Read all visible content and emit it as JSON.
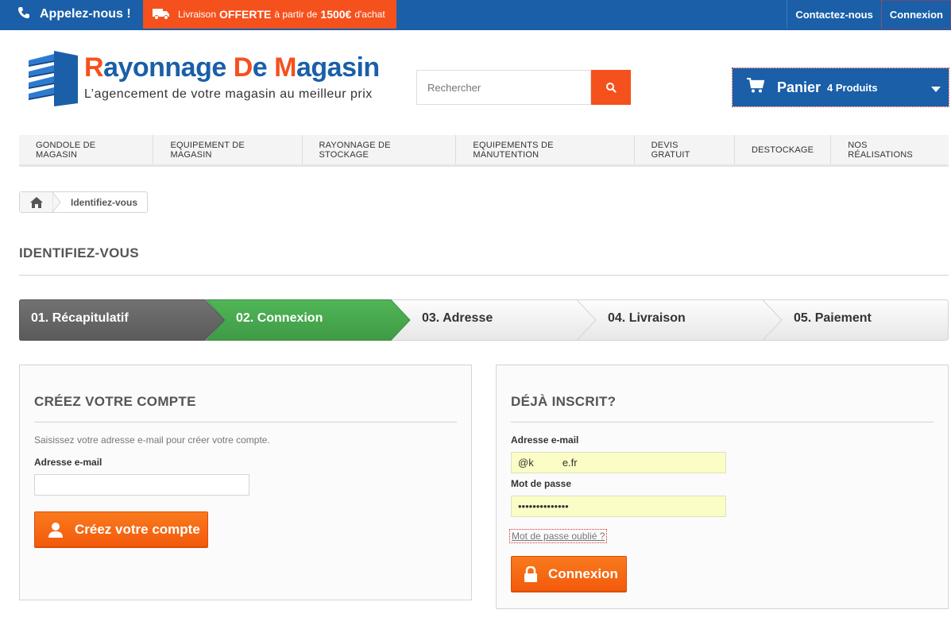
{
  "topbar": {
    "call_label": "Appelez-nous !",
    "promo": {
      "pre": "Livraison",
      "bold1": "OFFERTE",
      "mid": "à partir de",
      "bold2": "1500€",
      "post": "d'achat"
    },
    "links": [
      "Contactez-nous",
      "Connexion"
    ]
  },
  "logo": {
    "name_parts": [
      "R",
      "ayonnage ",
      "D",
      "e ",
      "M",
      "agasin"
    ],
    "tagline": "L’agencement de votre magasin au meilleur prix"
  },
  "search": {
    "placeholder": "Rechercher",
    "icon": "search-icon"
  },
  "cart": {
    "label": "Panier",
    "count": "4 Produits",
    "icon": "shopping-cart-icon"
  },
  "nav": [
    "GONDOLE DE MAGASIN",
    "EQUIPEMENT DE MAGASIN",
    "RAYONNAGE DE STOCKAGE",
    "EQUIPEMENTS DE MANUTENTION",
    "DEVIS GRATUIT",
    "DESTOCKAGE",
    "NOS RÉALISATIONS"
  ],
  "breadcrumb": {
    "home_icon": "home-icon",
    "current": "Identifiez-vous"
  },
  "page_title": "IDENTIFIEZ-VOUS",
  "steps": [
    {
      "label": "01. Récapitulatif",
      "state": "done"
    },
    {
      "label": "02. Connexion",
      "state": "current"
    },
    {
      "label": "03. Adresse",
      "state": "todo"
    },
    {
      "label": "04. Livraison",
      "state": "todo"
    },
    {
      "label": "05. Paiement",
      "state": "todo"
    }
  ],
  "create_account": {
    "title": "CRÉEZ VOTRE COMPTE",
    "description": "Saisissez votre adresse e-mail pour créer votre compte.",
    "email_label": "Adresse e-mail",
    "email_value": "",
    "button_label": "Créez votre compte"
  },
  "login": {
    "title": "DÉJÀ INSCRIT?",
    "email_label": "Adresse e-mail",
    "email_value": "@k          e.fr",
    "password_label": "Mot de passe",
    "password_value": "••••••••••••••",
    "forgot_label": "Mot de passe oublié ?",
    "button_label": "Connexion"
  },
  "colors": {
    "brand_blue": "#1a5fa8",
    "brand_orange": "#f5511d",
    "step_done": "#666666",
    "step_current": "#46a74e",
    "autofill_yellow": "#fafdc6"
  }
}
